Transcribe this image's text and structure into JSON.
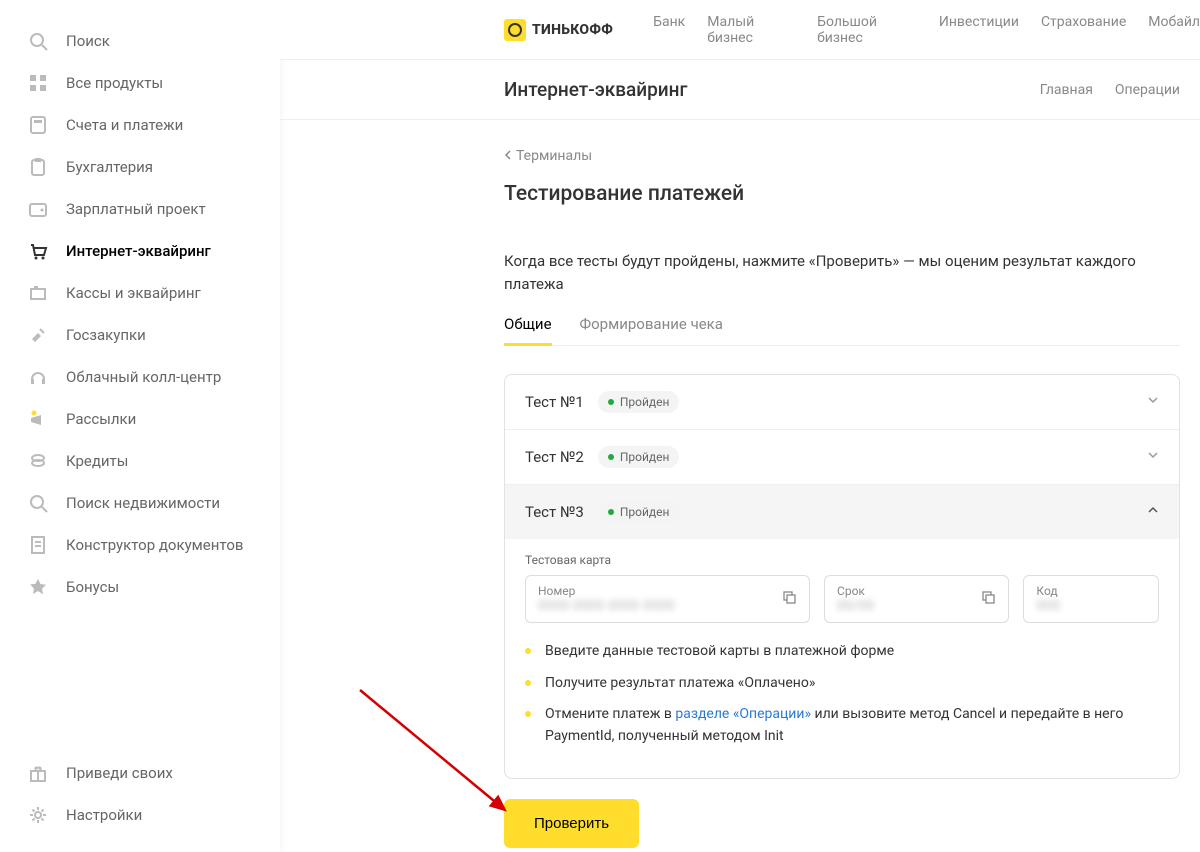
{
  "brand": "ТИНЬКОФФ",
  "topnav": [
    "Банк",
    "Малый бизнес",
    "Большой бизнес",
    "Инвестиции",
    "Страхование",
    "Мобайл"
  ],
  "subheader": {
    "title": "Интернет-эквайринг",
    "nav": [
      "Главная",
      "Операции"
    ]
  },
  "sidebar": {
    "items": [
      {
        "label": "Поиск",
        "icon": "search"
      },
      {
        "label": "Все продукты",
        "icon": "grid"
      },
      {
        "label": "Счета и платежи",
        "icon": "calc"
      },
      {
        "label": "Бухгалтерия",
        "icon": "clipboard"
      },
      {
        "label": "Зарплатный проект",
        "icon": "wallet"
      },
      {
        "label": "Интернет-эквайринг",
        "icon": "cart",
        "active": true
      },
      {
        "label": "Кассы и эквайринг",
        "icon": "register"
      },
      {
        "label": "Госзакупки",
        "icon": "gavel"
      },
      {
        "label": "Облачный колл-центр",
        "icon": "headset"
      },
      {
        "label": "Рассылки",
        "icon": "megaphone"
      },
      {
        "label": "Кредиты",
        "icon": "coins"
      },
      {
        "label": "Поиск недвижимости",
        "icon": "search-home"
      },
      {
        "label": "Конструктор документов",
        "icon": "doc"
      },
      {
        "label": "Бонусы",
        "icon": "star"
      }
    ],
    "bottom": [
      {
        "label": "Приведи своих",
        "icon": "gift"
      },
      {
        "label": "Настройки",
        "icon": "gear"
      }
    ]
  },
  "breadcrumb": "Терминалы",
  "pageTitle": "Тестирование платежей",
  "description": "Когда все тесты будут пройдены, нажмите «Проверить» — мы оценим результат каждого платежа",
  "tabs": [
    "Общие",
    "Формирование чека"
  ],
  "activeTab": 0,
  "tests": [
    {
      "name": "Тест №1",
      "status": "Пройден",
      "expanded": false
    },
    {
      "name": "Тест №2",
      "status": "Пройден",
      "expanded": false
    },
    {
      "name": "Тест №3",
      "status": "Пройден",
      "expanded": true
    }
  ],
  "testCard": {
    "heading": "Тестовая карта",
    "fields": [
      {
        "label": "Номер",
        "value": "0000 0000 0000 0000",
        "copy": true
      },
      {
        "label": "Срок",
        "value": "00/00",
        "copy": true
      },
      {
        "label": "Код",
        "value": "000",
        "copy": false
      }
    ]
  },
  "instructions": [
    {
      "text": "Введите данные тестовой карты в платежной форме"
    },
    {
      "text": "Получите результат платежа «Оплачено»"
    },
    {
      "prefix": "Отмените платеж в ",
      "link": "разделе «Операции»",
      "suffix": " или вызовите метод Cancel и передайте в него PaymentId, полученный методом Init"
    }
  ],
  "checkButton": "Проверить"
}
